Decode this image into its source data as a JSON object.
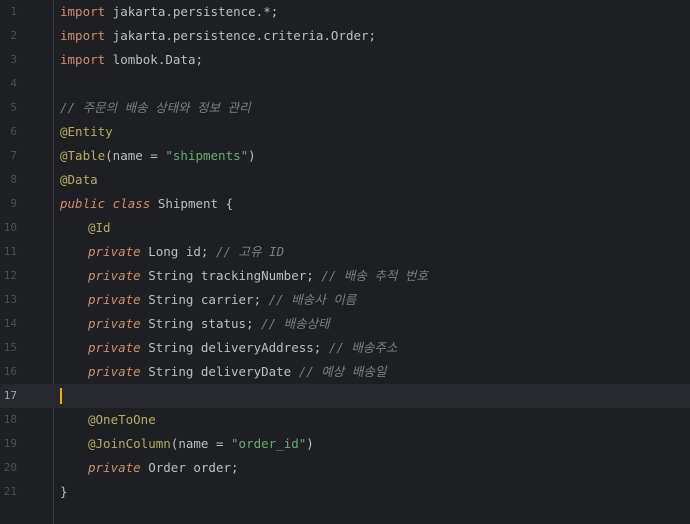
{
  "editor": {
    "lines": [
      {
        "number": "1",
        "tokens": [
          {
            "t": "import",
            "c": "kw"
          },
          {
            "t": " jakarta.persistence.*;",
            "c": "plain"
          }
        ]
      },
      {
        "number": "2",
        "tokens": [
          {
            "t": "import",
            "c": "kw"
          },
          {
            "t": " jakarta.persistence.criteria.Order;",
            "c": "plain"
          }
        ]
      },
      {
        "number": "3",
        "tokens": [
          {
            "t": "import",
            "c": "kw"
          },
          {
            "t": " lombok.Data;",
            "c": "plain"
          }
        ]
      },
      {
        "number": "4",
        "tokens": []
      },
      {
        "number": "5",
        "tokens": [
          {
            "t": "// 주문의 배송 상태와 정보 관리",
            "c": "cmt"
          }
        ]
      },
      {
        "number": "6",
        "tokens": [
          {
            "t": "@Entity",
            "c": "ann"
          }
        ]
      },
      {
        "number": "7",
        "tokens": [
          {
            "t": "@Table",
            "c": "ann"
          },
          {
            "t": "(name = ",
            "c": "plain"
          },
          {
            "t": "\"shipments\"",
            "c": "str"
          },
          {
            "t": ")",
            "c": "plain"
          }
        ]
      },
      {
        "number": "8",
        "tokens": [
          {
            "t": "@Data",
            "c": "ann"
          }
        ]
      },
      {
        "number": "9",
        "tokens": [
          {
            "t": "public class",
            "c": "kwi"
          },
          {
            "t": " Shipment {",
            "c": "plain"
          }
        ]
      },
      {
        "number": "10",
        "indent": true,
        "tokens": [
          {
            "t": "@Id",
            "c": "ann"
          }
        ]
      },
      {
        "number": "11",
        "indent": true,
        "tokens": [
          {
            "t": "private",
            "c": "kwi"
          },
          {
            "t": " Long id; ",
            "c": "plain"
          },
          {
            "t": "// 고유 ID",
            "c": "cmt"
          }
        ]
      },
      {
        "number": "12",
        "indent": true,
        "tokens": [
          {
            "t": "private",
            "c": "kwi"
          },
          {
            "t": " String trackingNumber; ",
            "c": "plain"
          },
          {
            "t": "// 배송 추적 번호",
            "c": "cmt"
          }
        ]
      },
      {
        "number": "13",
        "indent": true,
        "tokens": [
          {
            "t": "private",
            "c": "kwi"
          },
          {
            "t": " String carrier; ",
            "c": "plain"
          },
          {
            "t": "// 배송사 이름",
            "c": "cmt"
          }
        ]
      },
      {
        "number": "14",
        "indent": true,
        "tokens": [
          {
            "t": "private",
            "c": "kwi"
          },
          {
            "t": " String status; ",
            "c": "plain"
          },
          {
            "t": "// 배송상태",
            "c": "cmt"
          }
        ]
      },
      {
        "number": "15",
        "indent": true,
        "tokens": [
          {
            "t": "private",
            "c": "kwi"
          },
          {
            "t": " String deliveryAddress; ",
            "c": "plain"
          },
          {
            "t": "// 배송주소",
            "c": "cmt"
          }
        ]
      },
      {
        "number": "16",
        "indent": true,
        "tokens": [
          {
            "t": "private",
            "c": "kwi"
          },
          {
            "t": " String deliveryDate ",
            "c": "plain"
          },
          {
            "t": "// 예상 배송일",
            "c": "cmt"
          }
        ]
      },
      {
        "number": "17",
        "current": true,
        "tokens": []
      },
      {
        "number": "18",
        "indent": true,
        "tokens": [
          {
            "t": "@OneToOne",
            "c": "ann"
          }
        ]
      },
      {
        "number": "19",
        "indent": true,
        "tokens": [
          {
            "t": "@JoinColumn",
            "c": "ann"
          },
          {
            "t": "(name = ",
            "c": "plain"
          },
          {
            "t": "\"order_id\"",
            "c": "str"
          },
          {
            "t": ")",
            "c": "plain"
          }
        ]
      },
      {
        "number": "20",
        "indent": true,
        "tokens": [
          {
            "t": "private",
            "c": "kwi"
          },
          {
            "t": " Order order;",
            "c": "plain"
          }
        ]
      },
      {
        "number": "21",
        "tokens": [
          {
            "t": "}",
            "c": "plain"
          }
        ]
      }
    ]
  },
  "colors": {
    "background": "#1e1f22",
    "current_line": "#26282e",
    "keyword": "#cf8e6d",
    "annotation": "#b3ae60",
    "string": "#6aab73",
    "comment": "#7a7e85",
    "text": "#bcbec4",
    "caret": "#e8b400"
  }
}
